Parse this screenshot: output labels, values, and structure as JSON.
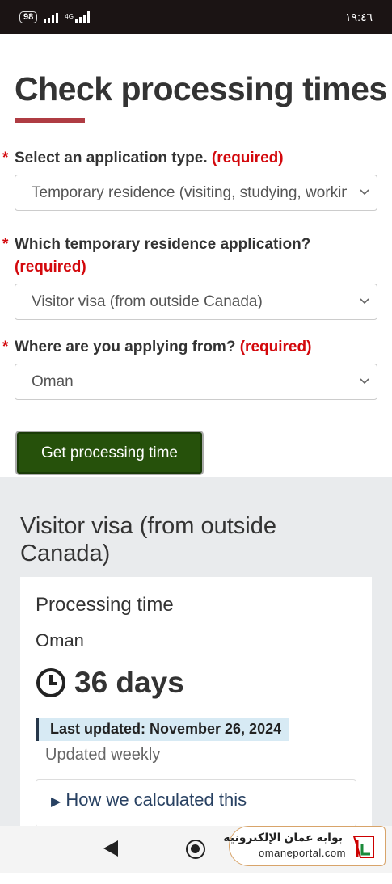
{
  "status": {
    "battery": "98",
    "network": "4G",
    "time": "١٩:٤٦"
  },
  "page_title": "Check processing times",
  "fields": [
    {
      "label": "Select an application type.",
      "required": "(required)",
      "value": "Temporary residence (visiting, studying, working)"
    },
    {
      "label": "Which temporary residence application?",
      "required": "(required)",
      "value": "Visitor visa (from outside Canada)"
    },
    {
      "label": "Where are you applying from?",
      "required": "(required)",
      "value": "Oman"
    }
  ],
  "submit_label": "Get processing time",
  "results": {
    "heading": "Visitor visa (from outside Canada)",
    "card_title": "Processing time",
    "country": "Oman",
    "days": "36 days",
    "last_updated": "Last updated: November 26, 2024",
    "frequency": "Updated weekly",
    "how_calculated": "How we calculated this"
  },
  "watermark": {
    "arabic": "بوابة عمان الإلكترونية",
    "url": "omaneportal.com"
  },
  "colors": {
    "required_red": "#d3080c",
    "button_green": "#26510b",
    "accent_bar": "#af3c43"
  },
  "icons": [
    "battery-icon",
    "signal-icon",
    "chevron-down-icon",
    "clock-icon",
    "triangle-right-icon",
    "back-icon",
    "home-icon"
  ]
}
